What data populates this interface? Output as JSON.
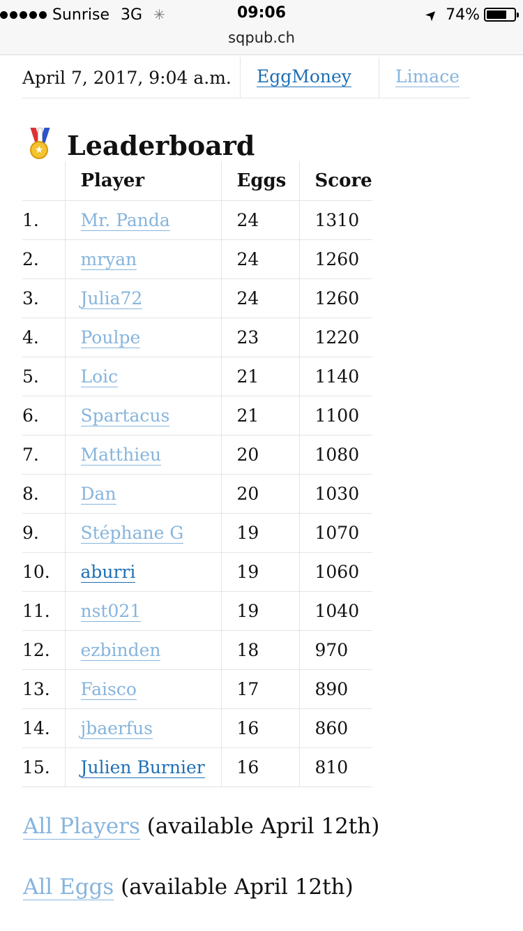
{
  "status_bar": {
    "carrier": "Sunrise",
    "network": "3G",
    "time": "09:06",
    "battery_text": "74%",
    "battery_level": 0.74,
    "url": "sqpub.ch"
  },
  "info_row": {
    "date": "April 7, 2017, 9:04 a.m.",
    "user_link": "EggMoney",
    "next_link": "Limace"
  },
  "leaderboard": {
    "title": "Leaderboard",
    "icon": "medal-icon",
    "headers": {
      "rank": "",
      "player": "Player",
      "eggs": "Eggs",
      "score": "Score"
    },
    "rows": [
      {
        "rank": "1.",
        "player": "Mr. Panda",
        "eggs": "24",
        "score": "1310",
        "visited": true
      },
      {
        "rank": "2.",
        "player": "mryan",
        "eggs": "24",
        "score": "1260",
        "visited": true
      },
      {
        "rank": "3.",
        "player": "Julia72",
        "eggs": "24",
        "score": "1260",
        "visited": true
      },
      {
        "rank": "4.",
        "player": "Poulpe",
        "eggs": "23",
        "score": "1220",
        "visited": true
      },
      {
        "rank": "5.",
        "player": "Loic",
        "eggs": "21",
        "score": "1140",
        "visited": true
      },
      {
        "rank": "6.",
        "player": "Spartacus",
        "eggs": "21",
        "score": "1100",
        "visited": true
      },
      {
        "rank": "7.",
        "player": "Matthieu",
        "eggs": "20",
        "score": "1080",
        "visited": true
      },
      {
        "rank": "8.",
        "player": "Dan",
        "eggs": "20",
        "score": "1030",
        "visited": true
      },
      {
        "rank": "9.",
        "player": "Stéphane G",
        "eggs": "19",
        "score": "1070",
        "visited": true
      },
      {
        "rank": "10.",
        "player": "aburri",
        "eggs": "19",
        "score": "1060",
        "visited": false
      },
      {
        "rank": "11.",
        "player": "nst021",
        "eggs": "19",
        "score": "1040",
        "visited": true
      },
      {
        "rank": "12.",
        "player": "ezbinden",
        "eggs": "18",
        "score": "970",
        "visited": true
      },
      {
        "rank": "13.",
        "player": "Faisco",
        "eggs": "17",
        "score": "890",
        "visited": true
      },
      {
        "rank": "14.",
        "player": "jbaerfus",
        "eggs": "16",
        "score": "860",
        "visited": true
      },
      {
        "rank": "15.",
        "player": "Julien Burnier",
        "eggs": "16",
        "score": "810",
        "visited": false
      }
    ]
  },
  "footer": {
    "players_link": "All Players",
    "players_note": " (available April 12th)",
    "eggs_link": "All Eggs",
    "eggs_note": " (available April 12th)"
  },
  "colors": {
    "link": "#1e6fb5",
    "visited_link": "#86b4dd",
    "divider": "#e4e4e4"
  }
}
